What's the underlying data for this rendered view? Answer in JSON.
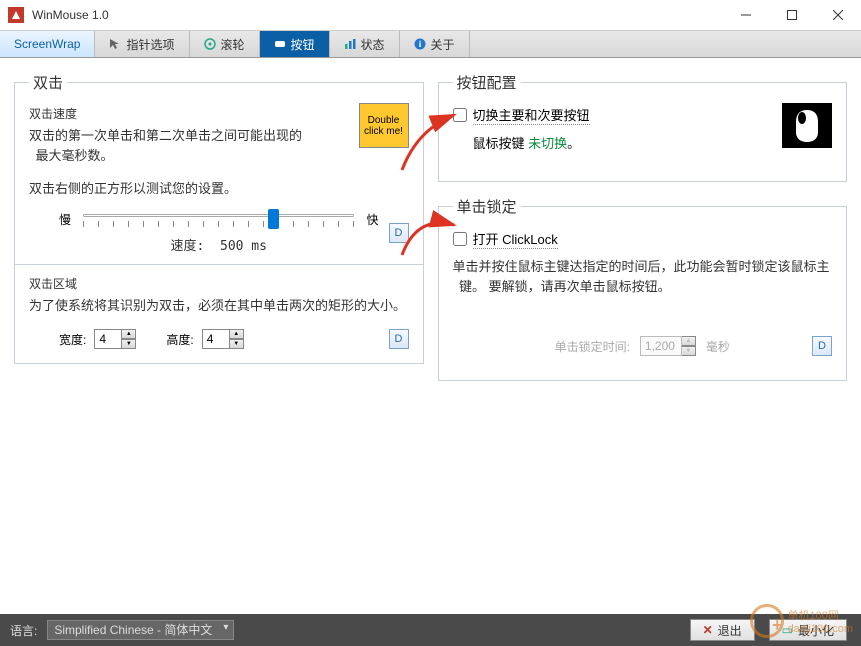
{
  "window": {
    "title": "WinMouse 1.0"
  },
  "tabs": [
    {
      "label": "ScreenWrap"
    },
    {
      "label": "指针选项"
    },
    {
      "label": "滚轮"
    },
    {
      "label": "按钮"
    },
    {
      "label": "状态"
    },
    {
      "label": "关于"
    }
  ],
  "doubleClick": {
    "title": "双击",
    "speedLabel": "双击速度",
    "speedDesc": "双击的第一次单击和第二次单击之间可能出现的最大毫秒数。",
    "testDesc": "双击右侧的正方形以测试您的设置。",
    "testBox": "Double click me!",
    "slow": "慢",
    "fast": "快",
    "speedValueLabel": "速度:",
    "speedValue": "500 ms",
    "areaLabel": "双击区域",
    "areaDesc": "为了使系统将其识别为双击，必须在其中单击两次的矩形的大小。",
    "widthLabel": "宽度:",
    "widthValue": "4",
    "heightLabel": "高度:",
    "heightValue": "4",
    "d": "D"
  },
  "buttonConfig": {
    "title": "按钮配置",
    "swapLabel": "切换主要和次要按钮",
    "statusPrefix": "鼠标按键",
    "statusValue": "未切换",
    "statusSuffix": "。"
  },
  "clickLock": {
    "title": "单击锁定",
    "openLabel": "打开 ClickLock",
    "desc": "单击并按住鼠标主键达指定的时间后，此功能会暂时锁定该鼠标主键。 要解锁，请再次单击鼠标按钮。",
    "timeLabel": "单击锁定时间:",
    "timeValue": "1,200",
    "timeUnit": "毫秒",
    "d": "D"
  },
  "bottombar": {
    "langLabel": "语言:",
    "langValue": "Simplified Chinese  -  简体中文",
    "exit": "退出",
    "minimize": "最小化"
  },
  "watermark": {
    "text": "单机100网",
    "url": "danji100.com"
  }
}
